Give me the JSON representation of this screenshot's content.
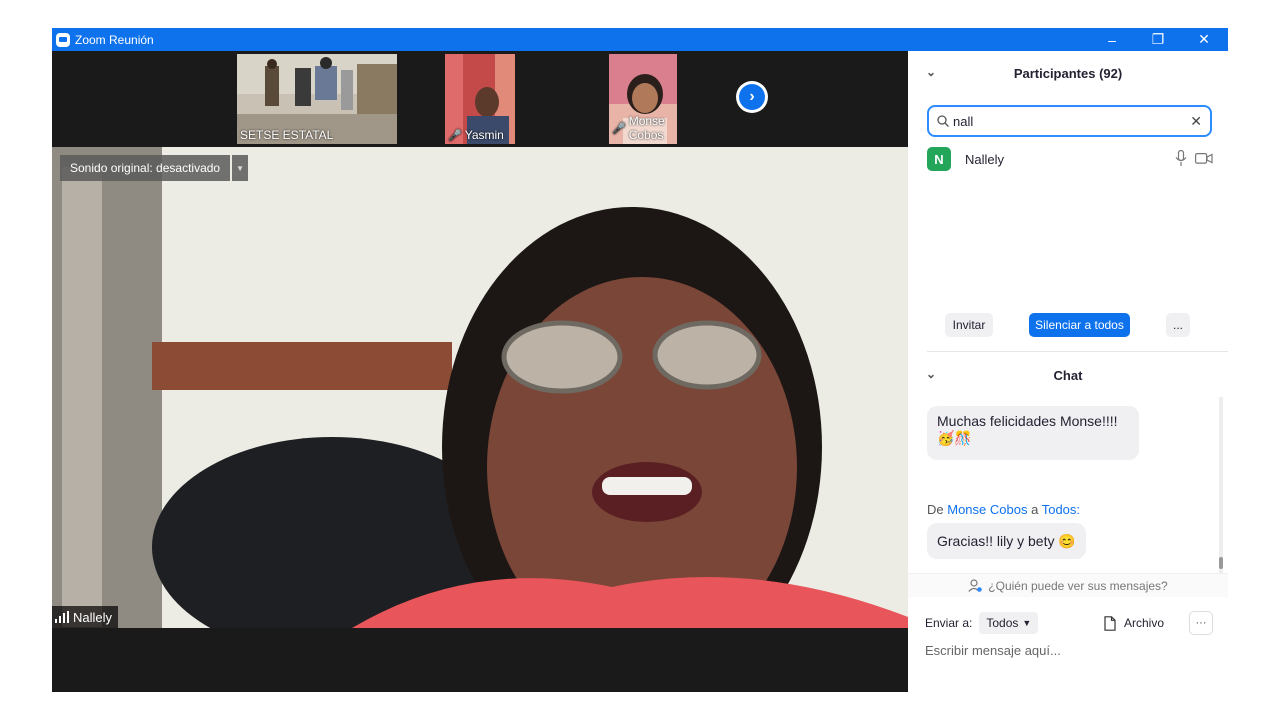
{
  "window": {
    "title": "Zoom Reunión",
    "controls": {
      "minimize": "–",
      "maximize": "❐",
      "close": "✕"
    }
  },
  "thumbnails": [
    {
      "name": "SETSE ESTATAL",
      "muted": false
    },
    {
      "name": "Yasmin",
      "muted": true
    },
    {
      "name": "Monse Cobos",
      "muted": true
    }
  ],
  "next_icon": "chevron-right-icon",
  "main_video": {
    "audio_label": "Sonido original: desactivado",
    "speaker_name": "Nallely"
  },
  "participants": {
    "header": "Participantes (92)",
    "search_value": "nall",
    "search_clear": "✕",
    "items": [
      {
        "initial": "N",
        "name": "Nallely",
        "color": "#23a55a"
      }
    ],
    "buttons": {
      "invite": "Invitar",
      "mute_all": "Silenciar a todos",
      "more": "..."
    }
  },
  "chat": {
    "header": "Chat",
    "messages": [
      {
        "text": "Muchas felicidades Monse!!!!",
        "emoji": "🥳🎊"
      }
    ],
    "from_prefix": "De",
    "from_sender": "Monse Cobos",
    "from_mid": "a",
    "from_target": "Todos:",
    "reply": "Gracias!! lily y bety 😊",
    "who_can_see": "¿Quién puede ver sus mensajes?",
    "send_to_label": "Enviar a:",
    "send_to_value": "Todos",
    "file_label": "Archivo",
    "more": "···",
    "input_placeholder": "Escribir mensaje aquí..."
  },
  "colors": {
    "accent": "#0e72ed",
    "avatar": "#23a55a",
    "titlebar": "#0e72ed"
  }
}
